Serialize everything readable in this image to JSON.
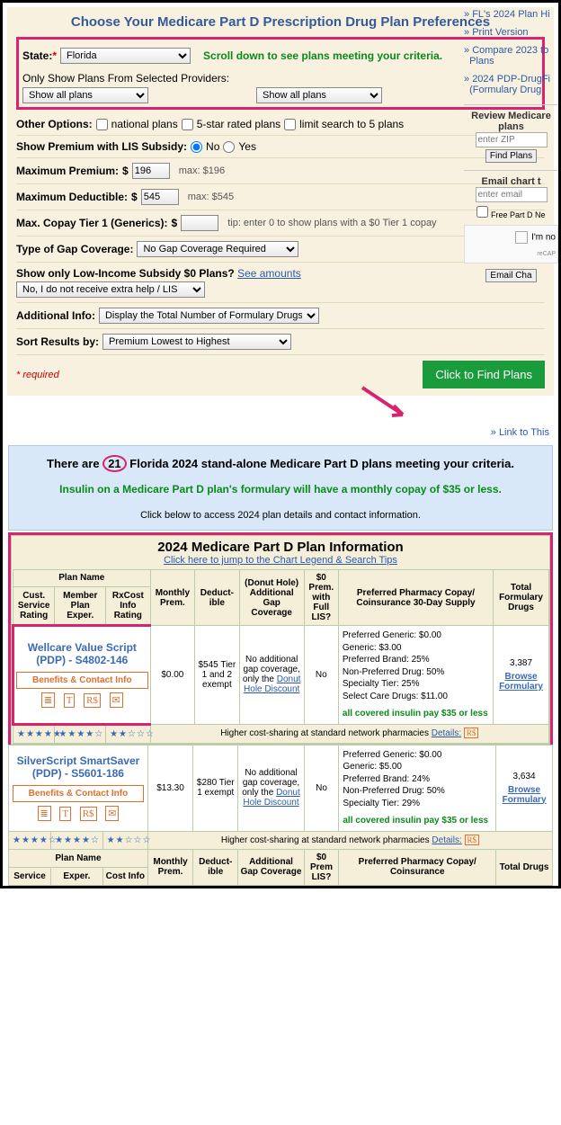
{
  "form": {
    "title": "Choose Your Medicare Part D Prescription Drug Plan Preferences",
    "state_label": "State:",
    "state_value": "Florida",
    "scroll_msg": "Scroll down to see plans meeting your criteria.",
    "providers_label": "Only Show Plans From Selected Providers:",
    "provider_a": "Show all plans",
    "provider_b": "Show all plans",
    "other_opts_label": "Other Options:",
    "opt1": "national plans",
    "opt2": "5-star rated plans",
    "opt3": "limit search to 5 plans",
    "lis_label": "Show Premium with LIS Subsidy:",
    "lis_no": "No",
    "lis_yes": "Yes",
    "max_prem_label": "Maximum Premium:",
    "max_prem_val": "196",
    "max_prem_note": "max: $196",
    "max_ded_label": "Maximum Deductible:",
    "max_ded_val": "545",
    "max_ded_note": "max: $545",
    "copay_label": "Max. Copay Tier 1 (Generics):",
    "copay_tip": "tip: enter 0 to show plans with a $0 Tier 1 copay",
    "gap_label": "Type of Gap Coverage:",
    "gap_val": "No Gap Coverage Required",
    "lis0_label": "Show only Low-Income Subsidy $0 Plans?",
    "see_amounts": "See amounts",
    "lis0_val": "No, I do not receive extra help / LIS",
    "addl_label": "Additional Info:",
    "addl_val": "Display the Total Number of Formulary Drugs",
    "sort_label": "Sort Results by:",
    "sort_val": "Premium Lowest to Highest",
    "required": "* required",
    "find_btn": "Click to Find Plans"
  },
  "sidebar": {
    "l1": "FL's 2024 Plan Hi",
    "l2": "Print Version",
    "l3": "Compare 2023 to",
    "l3b": "Plans",
    "l4": "2024 PDP-DrugFi",
    "l4b": "(Formulary Drug",
    "review_hd": "Review Medicare",
    "review_sub": "plans",
    "zip_ph": "enter ZIP",
    "find_plans": "Find Plans",
    "email_hd": "Email chart t",
    "email_ph": "enter email",
    "free_news": "Free Part D Ne",
    "captcha": "I'm no",
    "email_btn": "Email Cha"
  },
  "linkbar": "» Link to This",
  "banner": {
    "l1a": "There are",
    "l1_count": "21",
    "l1b": "Florida 2024 stand-alone Medicare Part D plans meeting your criteria.",
    "l2": "Insulin on a Medicare Part D plan's formulary will have a monthly copay of $35 or less.",
    "l3": "Click below to access 2024 plan details and contact information."
  },
  "table": {
    "title": "2024 Medicare Part D Plan Information",
    "legend": "Click here to jump to the Chart Legend & Search Tips",
    "h_plan": "Plan Name",
    "h_cust": "Cust. Service Rating",
    "h_member": "Member Plan Exper.",
    "h_rxcost": "RxCost Info Rating",
    "h_monthly": "Monthly Prem.",
    "h_deduct": "Deduct-ible",
    "h_gap_top": "(Donut Hole)",
    "h_gap": "Additional Gap Coverage",
    "h_zero": "$0 Prem. with Full LIS?",
    "h_pharm": "Preferred Pharmacy Copay/ Coinsurance 30-Day Supply",
    "h_drugs": "Total Formulary Drugs",
    "benefits": "Benefits & Contact Info",
    "shared": "Higher cost-sharing at standard network pharmacies",
    "details": "Details:",
    "donut_link": "Donut Hole Discount",
    "browse": "Browse Formulary",
    "insulin": "all covered insulin pay $35 or less",
    "foot_service": "Service",
    "foot_exper": "Exper.",
    "foot_cost": "Cost Info",
    "foot_gap": "Additional Gap Coverage",
    "foot_zero": "$0 Prem LIS?",
    "foot_pharm": "Preferred Pharmacy Copay/ Coinsurance",
    "foot_drugs": "Total Drugs"
  },
  "plans": [
    {
      "name": "Wellcare Value Script (PDP) - S4802-146",
      "premium": "$0.00",
      "deduct": "$545 Tier 1 and 2 exempt",
      "gap": "No additional gap coverage, only the",
      "zero": "No",
      "pharm": {
        "p1": "Preferred Generic: $0.00",
        "p2": "Generic: $3.00",
        "p3": "Preferred Brand: 25%",
        "p4": "Non-Preferred Drug: 50%",
        "p5": "Specialty Tier: 25%",
        "p6": "Select Care Drugs: $11.00"
      },
      "drugs": "3,387",
      "stars": {
        "s1": "★★★★★",
        "s2": "★★★★☆",
        "s3": "★★☆☆☆"
      }
    },
    {
      "name": "SilverScript SmartSaver (PDP) - S5601-186",
      "premium": "$13.30",
      "deduct": "$280 Tier 1 exempt",
      "gap": "No additional gap coverage, only the",
      "zero": "No",
      "pharm": {
        "p1": "Preferred Generic: $0.00",
        "p2": "Generic: $5.00",
        "p3": "Preferred Brand: 24%",
        "p4": "Non-Preferred Drug: 50%",
        "p5": "Specialty Tier: 29%",
        "p6": ""
      },
      "drugs": "3,634",
      "stars": {
        "s1": "★★★★☆",
        "s2": "★★★★☆",
        "s3": "★★☆☆☆"
      }
    }
  ]
}
